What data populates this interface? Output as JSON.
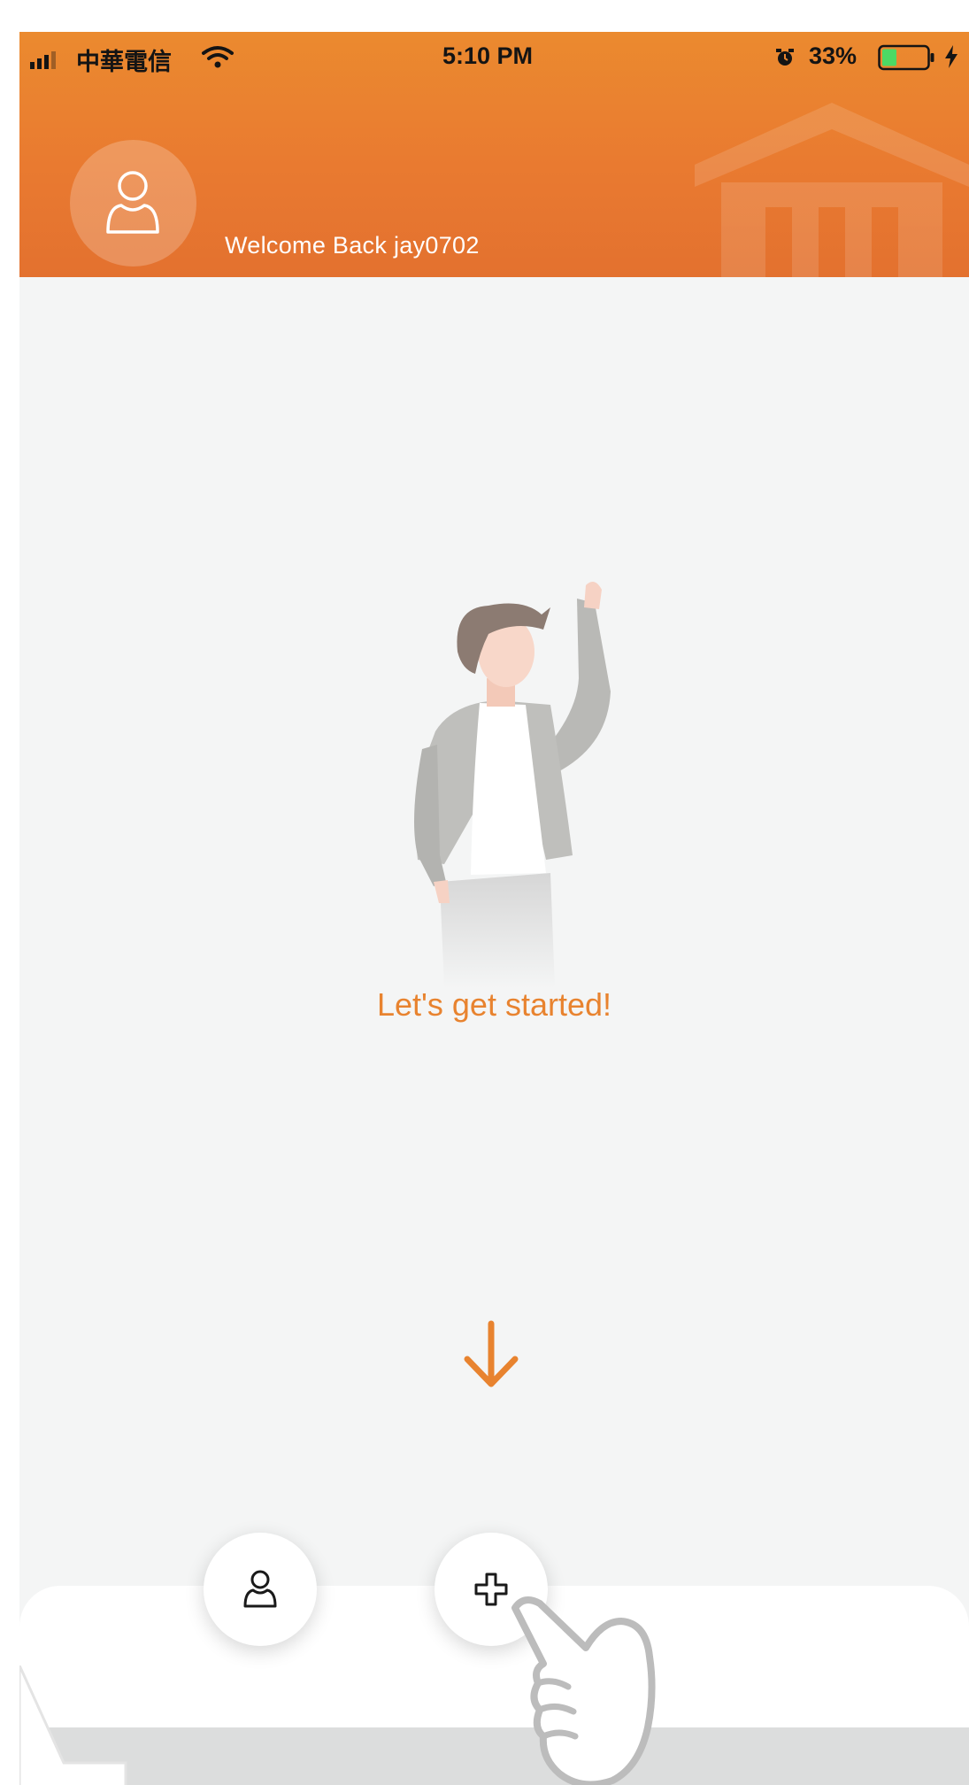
{
  "status_bar": {
    "carrier": "中華電信",
    "time": "5:10 PM",
    "battery_percent": "33%",
    "icons": [
      "signal-icon",
      "wifi-icon",
      "alarm-icon",
      "battery-icon",
      "charging-icon"
    ]
  },
  "header": {
    "welcome_text": "Welcome Back jay0702",
    "avatar_icon": "user-icon",
    "background_icon": "building-logo-icon"
  },
  "main": {
    "illustration": "waving-person-illustration",
    "message": "Let's get started!",
    "hint_icon": "arrow-down-icon"
  },
  "bottom_bar": {
    "buttons": [
      {
        "name": "profile",
        "icon": "user-icon"
      },
      {
        "name": "add",
        "icon": "plus-icon"
      }
    ],
    "overlay_icon": "pointing-hand-icon"
  },
  "colors": {
    "accent": "#e8832f",
    "header_top": "#eb8a2f",
    "background": "#f4f5f5",
    "battery_fill": "#4cd964"
  }
}
